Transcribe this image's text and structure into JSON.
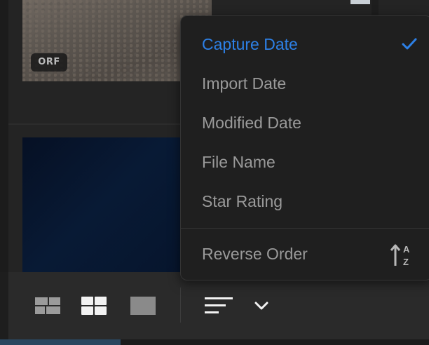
{
  "thumbnails": {
    "file_badge": "ORF"
  },
  "sort_menu": {
    "items": [
      {
        "label": "Capture Date",
        "selected": true
      },
      {
        "label": "Import Date",
        "selected": false
      },
      {
        "label": "Modified Date",
        "selected": false
      },
      {
        "label": "File Name",
        "selected": false
      },
      {
        "label": "Star Rating",
        "selected": false
      }
    ],
    "reverse_order_label": "Reverse Order",
    "selected_icon": "checkmark-icon",
    "reverse_icon": "sort-ascending-az-icon"
  },
  "toolbar": {
    "buttons": [
      {
        "icon": "compact-grid-view-icon",
        "active": false
      },
      {
        "icon": "large-grid-view-icon",
        "active": true
      },
      {
        "icon": "single-photo-view-icon",
        "active": false
      },
      {
        "icon": "sort-icon",
        "active": true
      },
      {
        "icon": "chevron-down-icon",
        "active": true
      }
    ]
  },
  "colors": {
    "accent": "#2d80e6",
    "menu_background": "#1f1f1f",
    "menu_text": "#9a9a9a",
    "toolbar_background": "#2a2a2a"
  }
}
